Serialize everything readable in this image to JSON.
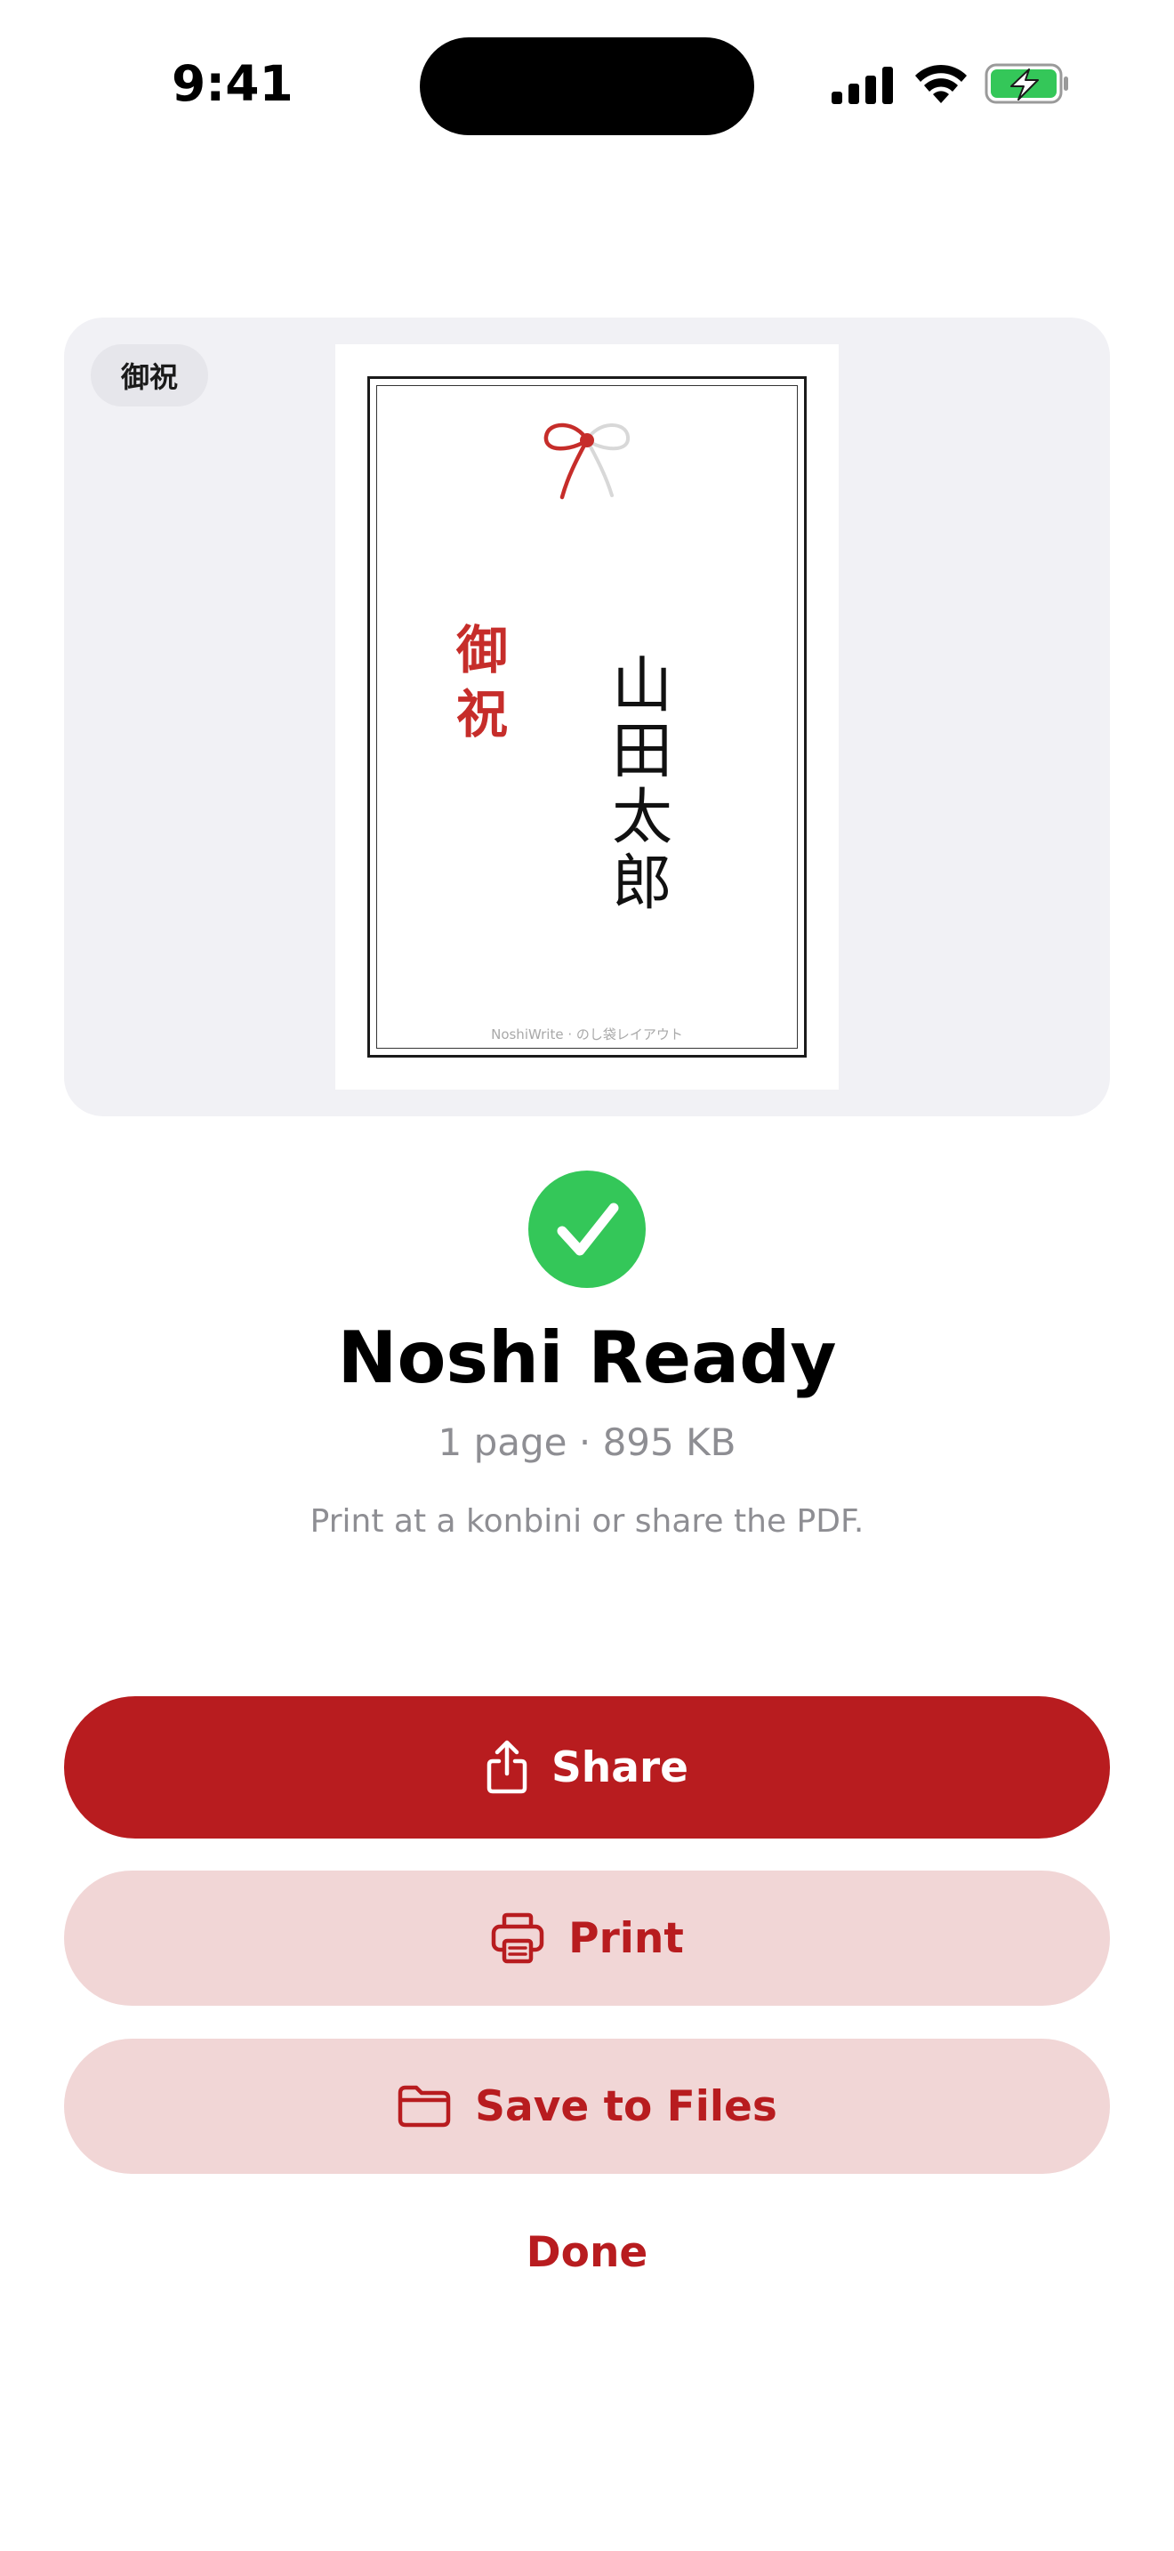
{
  "status_bar": {
    "time": "9:41"
  },
  "preview": {
    "category_chip": "御祝",
    "noshi": {
      "title_chars": [
        "御",
        "祝"
      ],
      "name_chars": [
        "山",
        "田",
        "太",
        "郎"
      ],
      "footer": "NoshiWrite · のし袋レイアウト"
    }
  },
  "result": {
    "title": "Noshi Ready",
    "meta": "1 page · 895 KB",
    "hint": "Print at a konbini or share the PDF."
  },
  "actions": {
    "share_label": "Share",
    "print_label": "Print",
    "save_label": "Save to Files",
    "done_label": "Done"
  },
  "icons": {
    "share": "share-icon",
    "print": "printer-icon",
    "save": "folder-icon",
    "success": "checkmark-icon",
    "signal": "cellular-signal-icon",
    "wifi": "wifi-icon",
    "battery": "battery-charging-icon"
  },
  "colors": {
    "accent": "#b81c1f",
    "accent_soft": "#f1d6d6",
    "success": "#34c759",
    "noshi_red": "#c62d2a",
    "secondary_text": "#8e8e93",
    "card_bg": "#f1f1f5"
  }
}
